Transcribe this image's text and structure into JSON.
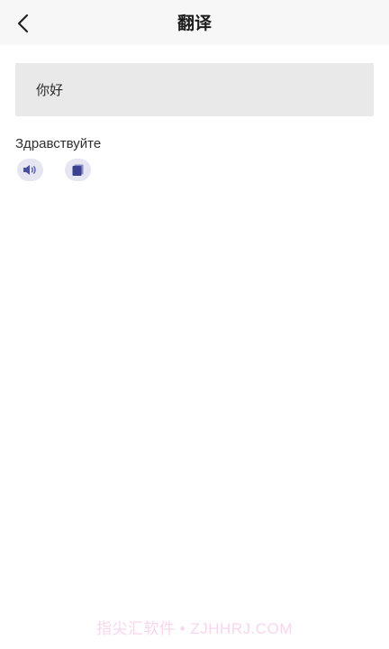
{
  "header": {
    "title": "翻译",
    "back_icon": "chevron-left-icon"
  },
  "source": {
    "text": "你好"
  },
  "result": {
    "text": "Здравствуйте"
  },
  "actions": {
    "speak_icon": "speaker-icon",
    "copy_icon": "copy-icon",
    "accent_color": "#4a4fa0"
  },
  "watermark": {
    "text": "指尖汇软件 • ZJHHRJ.COM"
  }
}
